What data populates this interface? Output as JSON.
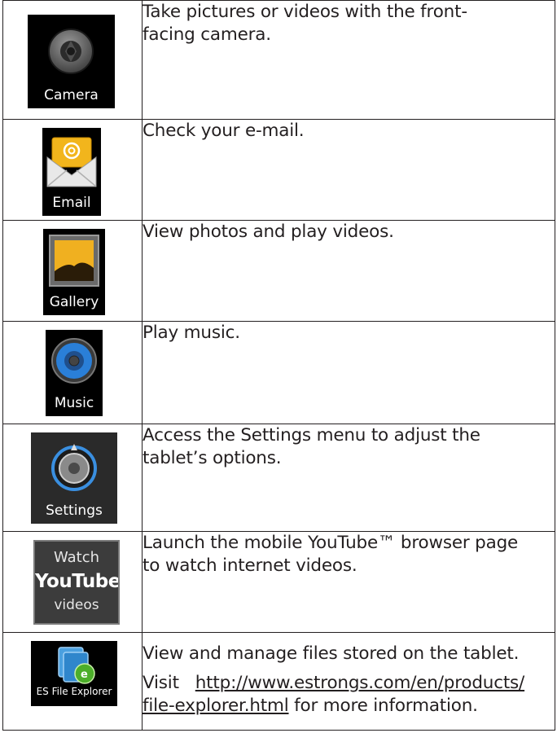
{
  "apps": [
    {
      "icon": "camera-icon",
      "label": "Camera",
      "description": [
        "Take pictures or videos with the front-",
        "facing camera."
      ]
    },
    {
      "icon": "email-icon",
      "label": "Email",
      "description": [
        "Check your e-mail."
      ]
    },
    {
      "icon": "gallery-icon",
      "label": "Gallery",
      "description": [
        "View photos and play videos."
      ]
    },
    {
      "icon": "music-icon",
      "label": "Music",
      "description": [
        "Play music."
      ]
    },
    {
      "icon": "settings-icon",
      "label": "Settings",
      "description": [
        "Access the Settings menu to adjust the",
        "tablet’s options."
      ]
    },
    {
      "icon": "youtube-icon",
      "label_lines": [
        "Watch",
        "YouTube",
        "videos"
      ],
      "description": [
        "Launch the mobile YouTube™ browser page",
        "to watch internet videos."
      ]
    },
    {
      "icon": "es-file-explorer-icon",
      "label": "ES File Explorer",
      "description": [
        "View and manage files stored on the tablet."
      ],
      "visit": {
        "prefix": "Visit",
        "link_line1": "http://www.estrongs.com/en/products/",
        "link_line2": "file-explorer.html",
        "suffix": " for more information."
      }
    }
  ],
  "colors": {
    "text": "#231f20",
    "tile_bg": "#000000",
    "email_yellow": "#f2b51c",
    "gallery_gold": "#f0b020",
    "music_blue": "#2a7fd8",
    "settings_blue": "#3a8fe0"
  }
}
